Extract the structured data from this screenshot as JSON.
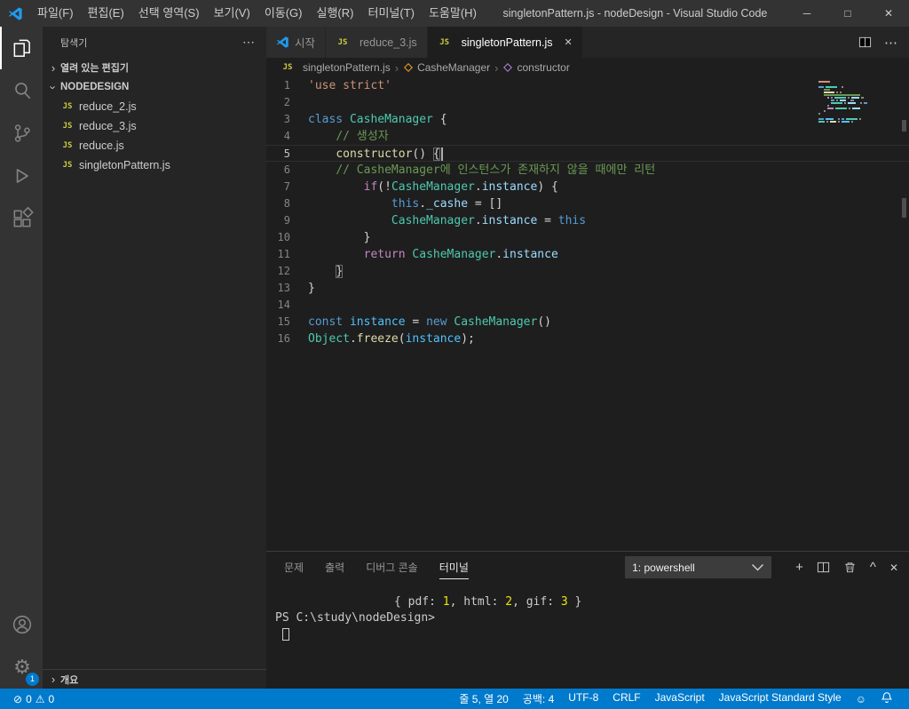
{
  "icons": {
    "close": "✕",
    "more": "⋯",
    "chevron_collapsed": "›",
    "plus": "+",
    "chevron_up": "^",
    "gear": "⚙",
    "error": "⊘",
    "warning": "⚠",
    "feedback": "☺",
    "minimize": "─",
    "maximize": "□"
  },
  "titlebar": {
    "menus": [
      "파일(F)",
      "편집(E)",
      "선택 영역(S)",
      "보기(V)",
      "이동(G)",
      "실행(R)",
      "터미널(T)",
      "도움말(H)"
    ],
    "title": "singletonPattern.js - nodeDesign - Visual Studio Code"
  },
  "sidebar": {
    "title": "탐색기",
    "sections": {
      "open_editors": "열려 있는 편집기",
      "folder": "NODEDESIGN",
      "outline": "개요"
    },
    "files": [
      "reduce_2.js",
      "reduce_3.js",
      "reduce.js",
      "singletonPattern.js"
    ]
  },
  "tabs": [
    {
      "label": "시작",
      "icon": "vscode"
    },
    {
      "label": "reduce_3.js",
      "icon": "js"
    },
    {
      "label": "singletonPattern.js",
      "icon": "js"
    }
  ],
  "breadcrumb": {
    "file": "singletonPattern.js",
    "class": "CasheManager",
    "method": "constructor",
    "separator": "›"
  },
  "code": {
    "lines": [
      {
        "n": 1,
        "tokens": [
          [
            "str",
            "'use strict'"
          ]
        ]
      },
      {
        "n": 2,
        "tokens": []
      },
      {
        "n": 3,
        "tokens": [
          [
            "kw",
            "class "
          ],
          [
            "cls",
            "CasheManager"
          ],
          [
            "pun",
            " {"
          ]
        ]
      },
      {
        "n": 4,
        "tokens": [
          [
            "pun",
            "    "
          ],
          [
            "cmt",
            "// 생성자"
          ]
        ]
      },
      {
        "n": 5,
        "tokens": [
          [
            "pun",
            "    "
          ],
          [
            "fn",
            "constructor"
          ],
          [
            "pun",
            "() "
          ],
          [
            "brkt",
            "{"
          ]
        ],
        "current": true,
        "cursor": true
      },
      {
        "n": 6,
        "tokens": [
          [
            "pun",
            "    "
          ],
          [
            "cmt",
            "// CasheManager에 인스턴스가 존재하지 않을 때에만 리턴"
          ]
        ]
      },
      {
        "n": 7,
        "tokens": [
          [
            "pun",
            "        "
          ],
          [
            "ctrl",
            "if"
          ],
          [
            "pun",
            "(!"
          ],
          [
            "cls",
            "CasheManager"
          ],
          [
            "pun",
            "."
          ],
          [
            "prop",
            "instance"
          ],
          [
            "pun",
            ") {"
          ]
        ]
      },
      {
        "n": 8,
        "tokens": [
          [
            "pun",
            "            "
          ],
          [
            "kw",
            "this"
          ],
          [
            "pun",
            "."
          ],
          [
            "prop",
            "_cashe"
          ],
          [
            "pun",
            " = []"
          ]
        ]
      },
      {
        "n": 9,
        "tokens": [
          [
            "pun",
            "            "
          ],
          [
            "cls",
            "CasheManager"
          ],
          [
            "pun",
            "."
          ],
          [
            "prop",
            "instance"
          ],
          [
            "pun",
            " = "
          ],
          [
            "kw",
            "this"
          ]
        ]
      },
      {
        "n": 10,
        "tokens": [
          [
            "pun",
            "        }"
          ]
        ]
      },
      {
        "n": 11,
        "tokens": [
          [
            "pun",
            "        "
          ],
          [
            "ctrl",
            "return "
          ],
          [
            "cls",
            "CasheManager"
          ],
          [
            "pun",
            "."
          ],
          [
            "prop",
            "instance"
          ]
        ]
      },
      {
        "n": 12,
        "tokens": [
          [
            "pun",
            "    "
          ],
          [
            "brkt",
            "}"
          ]
        ]
      },
      {
        "n": 13,
        "tokens": [
          [
            "pun",
            "}"
          ]
        ]
      },
      {
        "n": 14,
        "tokens": []
      },
      {
        "n": 15,
        "tokens": [
          [
            "kw",
            "const "
          ],
          [
            "var",
            "instance"
          ],
          [
            "pun",
            " = "
          ],
          [
            "kw",
            "new "
          ],
          [
            "cls",
            "CasheManager"
          ],
          [
            "pun",
            "()"
          ]
        ]
      },
      {
        "n": 16,
        "tokens": [
          [
            "cls",
            "Object"
          ],
          [
            "pun",
            "."
          ],
          [
            "fn",
            "freeze"
          ],
          [
            "pun",
            "("
          ],
          [
            "var",
            "instance"
          ],
          [
            "pun",
            ");"
          ]
        ]
      }
    ]
  },
  "panel": {
    "tabs": [
      {
        "name": "problems",
        "label": "문제",
        "active": false
      },
      {
        "name": "output",
        "label": "출력",
        "active": false
      },
      {
        "name": "debug-console",
        "label": "디버그 콘솔",
        "active": false
      },
      {
        "name": "terminal",
        "label": "터미널",
        "active": true
      }
    ],
    "shell_selector": "1: powershell",
    "terminal": {
      "output_line": [
        [
          "txt",
          "{ pdf: "
        ],
        [
          "num",
          "1"
        ],
        [
          "txt",
          ", html: "
        ],
        [
          "num",
          "2"
        ],
        [
          "txt",
          ", gif: "
        ],
        [
          "num",
          "3"
        ],
        [
          "txt",
          " }"
        ]
      ],
      "prompt": "PS C:\\study\\nodeDesign>"
    }
  },
  "statusbar": {
    "errors": "0",
    "warnings": "0",
    "right_items": [
      {
        "name": "cursor-position",
        "label": "줄 5, 열 20"
      },
      {
        "name": "indentation",
        "label": "공백: 4"
      },
      {
        "name": "encoding",
        "label": "UTF-8"
      },
      {
        "name": "eol",
        "label": "CRLF"
      },
      {
        "name": "language-mode",
        "label": "JavaScript"
      },
      {
        "name": "linter",
        "label": "JavaScript Standard Style"
      }
    ]
  }
}
